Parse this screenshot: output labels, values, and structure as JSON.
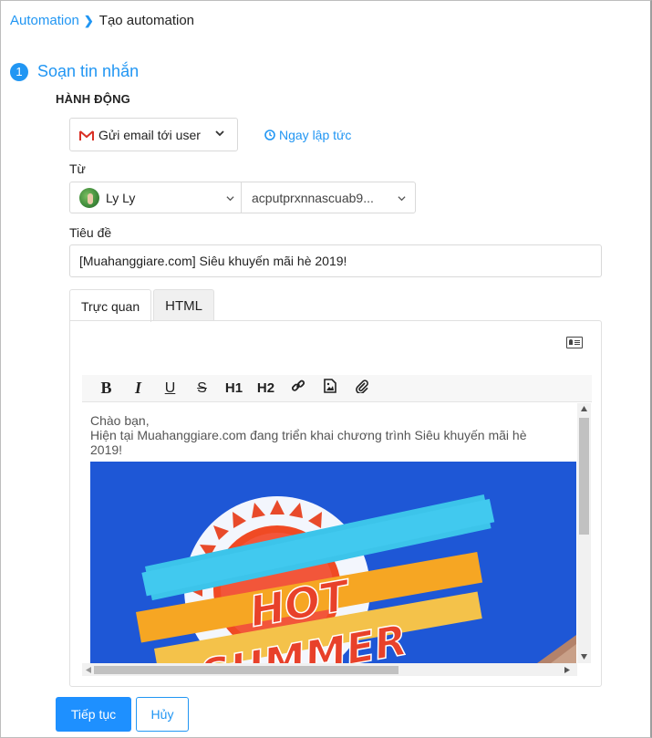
{
  "breadcrumb": {
    "parent": "Automation",
    "current": "Tạo automation"
  },
  "step": {
    "number": "1",
    "title": "Soạn tin nhắn"
  },
  "action": {
    "section_title": "HÀNH ĐỘNG",
    "type_label": "Gửi email tới user",
    "type_icon": "gmail-icon",
    "timing": "Ngay lập tức",
    "timing_icon": "clock-icon"
  },
  "from": {
    "label": "Từ",
    "sender_name": "Ly Ly",
    "sender_email": "acputprxnnascuab9..."
  },
  "subject": {
    "label": "Tiêu đề",
    "value": "[Muahanggiare.com] Siêu khuyến mãi hè 2019!"
  },
  "tabs": [
    {
      "label": "Trực quan",
      "active": true
    },
    {
      "label": "HTML",
      "active": false
    }
  ],
  "toolbar": {
    "bold": "B",
    "italic": "I",
    "underline": "U",
    "strike": "S",
    "h1": "H1",
    "h2": "H2"
  },
  "body": {
    "line1": "Chào bạn,",
    "line2": "Hiện tại Muahanggiare.com đang triển khai chương trình Siêu khuyến mãi hè 2019!",
    "banner_text_1": "HOT",
    "banner_text_2": "SUMMER"
  },
  "buttons": {
    "continue": "Tiếp tục",
    "cancel": "Hủy"
  },
  "colors": {
    "accent": "#2196f3",
    "primary_button": "#1e90ff",
    "banner_bg": "#1e57d6"
  }
}
